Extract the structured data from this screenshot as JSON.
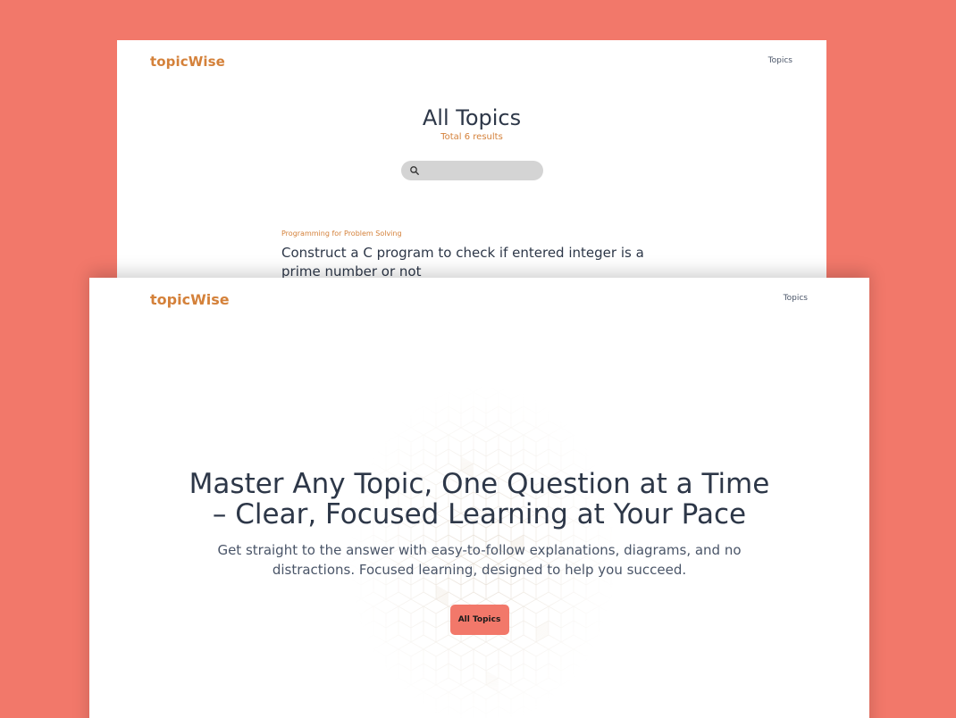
{
  "back_page": {
    "brand": "topicWise",
    "nav": {
      "topics_label": "Topics"
    },
    "title": "All Topics",
    "results_text": "Total 6 results",
    "search": {
      "value": "",
      "placeholder": ""
    },
    "topics": [
      {
        "category": "Programming for Problem Solving",
        "title": "Construct a C program to check if entered integer is a prime number or not"
      }
    ]
  },
  "front_page": {
    "brand": "topicWise",
    "nav": {
      "topics_label": "Topics"
    },
    "hero": {
      "title": "Master Any Topic, One Question at a Time – Clear, Focused Learning at Your Pace",
      "subtitle": "Get straight to the answer with easy-to-follow explanations, diagrams, and no distractions. Focused learning, designed to help you succeed.",
      "cta_label": "All Topics"
    }
  },
  "colors": {
    "background": "#f2786a",
    "brand": "#d4813a",
    "heading": "#2d3748",
    "button": "#f2786a",
    "search_bg": "#d4d4d4"
  },
  "icons": {
    "search": "search-icon"
  }
}
